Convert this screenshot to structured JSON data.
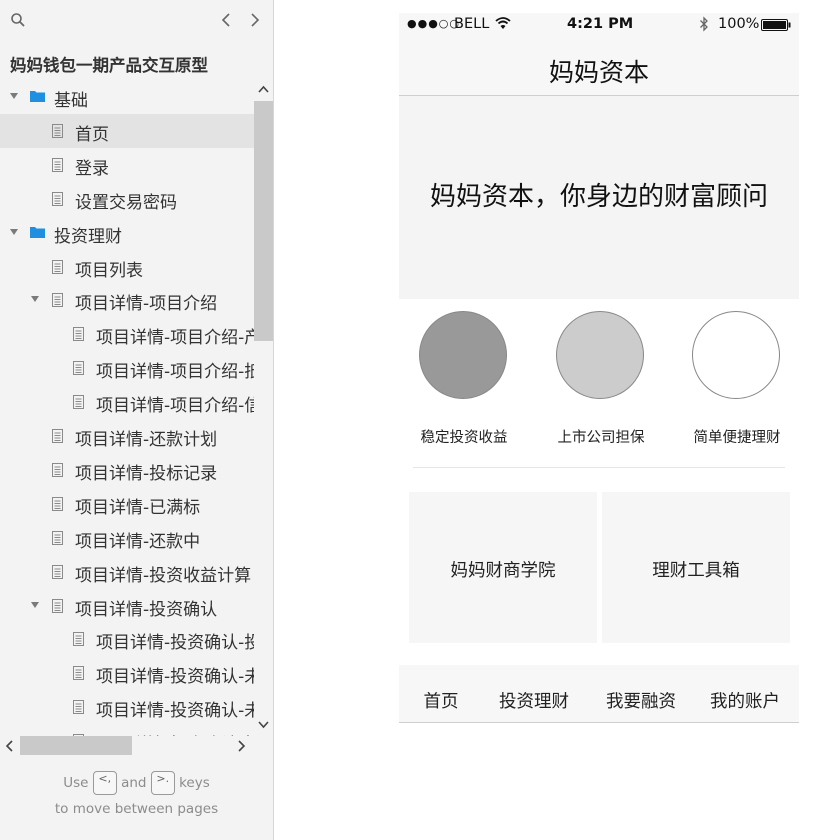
{
  "sidebar": {
    "title": "妈妈钱包一期产品交互原型",
    "tree": [
      {
        "label": "基础",
        "type": "folder",
        "level": 0,
        "expanded": true
      },
      {
        "label": "首页",
        "type": "page",
        "level": 1,
        "selected": true
      },
      {
        "label": "登录",
        "type": "page",
        "level": 1
      },
      {
        "label": "设置交易密码",
        "type": "page",
        "level": 1
      },
      {
        "label": "投资理财",
        "type": "folder",
        "level": 0,
        "expanded": true
      },
      {
        "label": "项目列表",
        "type": "page",
        "level": 1
      },
      {
        "label": "项目详情-项目介绍",
        "type": "page",
        "level": 1,
        "expanded": true
      },
      {
        "label": "项目详情-项目介绍-产",
        "type": "page",
        "level": 2
      },
      {
        "label": "项目详情-项目介绍-抵",
        "type": "page",
        "level": 2
      },
      {
        "label": "项目详情-项目介绍-信",
        "type": "page",
        "level": 2
      },
      {
        "label": "项目详情-还款计划",
        "type": "page",
        "level": 1
      },
      {
        "label": "项目详情-投标记录",
        "type": "page",
        "level": 1
      },
      {
        "label": "项目详情-已满标",
        "type": "page",
        "level": 1
      },
      {
        "label": "项目详情-还款中",
        "type": "page",
        "level": 1
      },
      {
        "label": "项目详情-投资收益计算",
        "type": "page",
        "level": 1
      },
      {
        "label": "项目详情-投资确认",
        "type": "page",
        "level": 1,
        "expanded": true
      },
      {
        "label": "项目详情-投资确认-投",
        "type": "page",
        "level": 2
      },
      {
        "label": "项目详情-投资确认-未",
        "type": "page",
        "level": 2
      },
      {
        "label": "项目详情-投资确认-未",
        "type": "page",
        "level": 2
      },
      {
        "label": "项目详情-投资确认-投",
        "type": "page",
        "level": 2
      }
    ],
    "hint": {
      "use": "Use",
      "key_prev": "<,",
      "and": "and",
      "key_next": ">.",
      "keys": "keys",
      "line2": "to move between pages"
    }
  },
  "phone": {
    "status": {
      "signal": "●●●○○",
      "carrier": "BELL",
      "time": "4:21 PM",
      "battery": "100%"
    },
    "nav_title": "妈妈资本",
    "banner": "妈妈资本，你身边的财富顾问",
    "features": [
      {
        "label": "稳定投资收益",
        "fill": "#999999"
      },
      {
        "label": "上市公司担保",
        "fill": "#cccccc"
      },
      {
        "label": "简单便捷理财",
        "fill": "#ffffff"
      }
    ],
    "tiles": [
      "妈妈财商学院",
      "理财工具箱"
    ],
    "tabs": [
      "首页",
      "投资理财",
      "我要融资",
      "我的账户"
    ]
  }
}
